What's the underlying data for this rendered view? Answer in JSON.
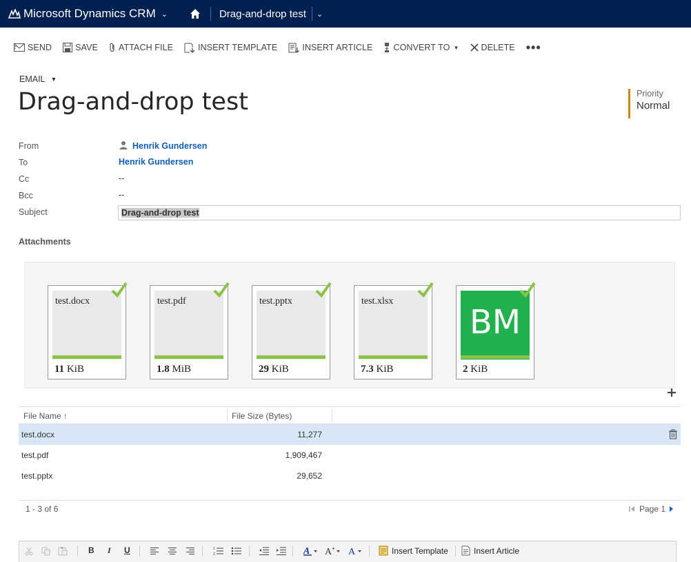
{
  "topbar": {
    "app_name": "Microsoft Dynamics CRM",
    "breadcrumb": "Drag-and-drop test",
    "colors": {
      "background": "#002050"
    }
  },
  "commands": [
    {
      "label": "SEND",
      "icon": "send-icon"
    },
    {
      "label": "SAVE",
      "icon": "save-icon"
    },
    {
      "label": "ATTACH FILE",
      "icon": "paperclip-icon"
    },
    {
      "label": "INSERT TEMPLATE",
      "icon": "insert-template-icon"
    },
    {
      "label": "INSERT ARTICLE",
      "icon": "insert-article-icon"
    },
    {
      "label": "CONVERT TO",
      "icon": "convert-icon"
    },
    {
      "label": "DELETE",
      "icon": "delete-icon"
    }
  ],
  "header": {
    "entity_type": "EMAIL",
    "title": "Drag-and-drop test",
    "priority_label": "Priority",
    "priority_value": "Normal"
  },
  "form": {
    "from_label": "From",
    "from_value": "Henrik Gundersen",
    "to_label": "To",
    "to_value": "Henrik Gundersen",
    "cc_label": "Cc",
    "cc_value": "--",
    "bcc_label": "Bcc",
    "bcc_value": "--",
    "subject_label": "Subject",
    "subject_value": "Drag-and-drop test"
  },
  "attachments": {
    "title": "Attachments",
    "tiles": [
      {
        "name": "test.docx",
        "size_num": "11",
        "size_unit": " KiB",
        "thumb": ""
      },
      {
        "name": "test.pdf",
        "size_num": "1.8",
        "size_unit": " MiB",
        "thumb": ""
      },
      {
        "name": "test.pptx",
        "size_num": "29",
        "size_unit": " KiB",
        "thumb": ""
      },
      {
        "name": "test.xlsx",
        "size_num": "7.3",
        "size_unit": " KiB",
        "thumb": ""
      },
      {
        "name": "",
        "size_num": "2",
        "size_unit": " KiB",
        "thumb": "BM"
      }
    ],
    "colors": {
      "progress": "#8bc34a",
      "check": "#8bc34a",
      "image_thumb": "#22b14c"
    }
  },
  "grid": {
    "columns": [
      "File Name",
      "File Size (Bytes)"
    ],
    "rows": [
      {
        "name": "test.docx",
        "size": "11,277"
      },
      {
        "name": "test.pdf",
        "size": "1,909,467"
      },
      {
        "name": "test.pptx",
        "size": "29,652"
      }
    ],
    "footer_count": "1 - 3 of 6",
    "page_label": "Page 1"
  },
  "editor": {
    "bold": "B",
    "italic": "I",
    "underline": "U",
    "insert_template": "Insert Template",
    "insert_article": "Insert Article"
  }
}
